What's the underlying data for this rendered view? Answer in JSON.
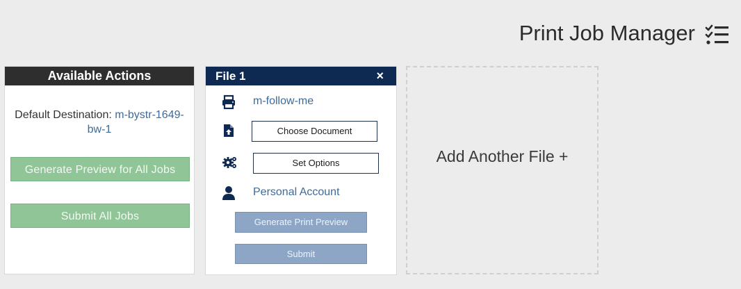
{
  "header": {
    "title": "Print Job Manager",
    "icon": "checklist-icon"
  },
  "actions": {
    "title": "Available Actions",
    "default_destination_label": "Default Destination:",
    "default_destination_value": "m-bystr-1649-bw-1",
    "generate_all_label": "Generate Preview for All Jobs",
    "submit_all_label": "Submit All Jobs"
  },
  "file": {
    "title": "File 1",
    "close_label": "×",
    "printer": "m-follow-me",
    "choose_document_label": "Choose Document",
    "set_options_label": "Set Options",
    "account": "Personal Account",
    "generate_preview_label": "Generate Print Preview",
    "submit_label": "Submit"
  },
  "add_file": {
    "label": "Add Another File +"
  },
  "colors": {
    "background": "#ececec",
    "actions_header": "#2e2e2e",
    "file_header": "#0f2a52",
    "green_button": "#8fc597",
    "blue_button": "#8ea6c6",
    "link": "#3e6a99"
  }
}
